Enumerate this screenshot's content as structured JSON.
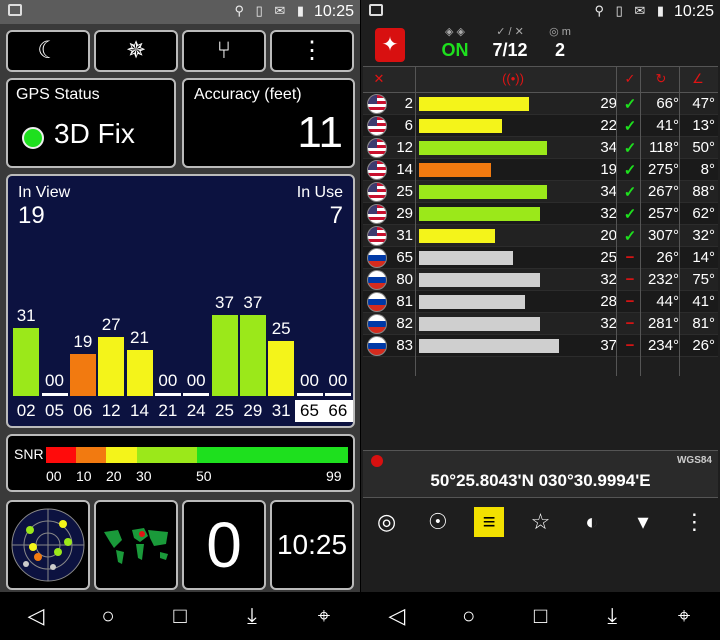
{
  "left": {
    "status_time": "10:25",
    "toolbar": {
      "night_icon": "☾",
      "compass_icon": "✵",
      "share_icon": "⑂",
      "menu_icon": "⋮"
    },
    "gps_status": {
      "label": "GPS Status",
      "value": "3D Fix"
    },
    "accuracy": {
      "label": "Accuracy (feet)",
      "value": "11"
    },
    "sky": {
      "in_view_label": "In View",
      "in_view": "19",
      "in_use_label": "In Use",
      "in_use": "7",
      "bars": [
        {
          "prn": "02",
          "snr": "31",
          "color": "#9be81a",
          "boxed": false
        },
        {
          "prn": "05",
          "snr": "00",
          "color": "#9be81a",
          "boxed": false
        },
        {
          "prn": "06",
          "snr": "19",
          "color": "#f27a10",
          "boxed": false
        },
        {
          "prn": "12",
          "snr": "27",
          "color": "#f4f41a",
          "boxed": false
        },
        {
          "prn": "14",
          "snr": "21",
          "color": "#f4f41a",
          "boxed": false
        },
        {
          "prn": "21",
          "snr": "00",
          "color": "#9be81a",
          "boxed": false
        },
        {
          "prn": "24",
          "snr": "00",
          "color": "#9be81a",
          "boxed": false
        },
        {
          "prn": "25",
          "snr": "37",
          "color": "#9be81a",
          "boxed": false
        },
        {
          "prn": "29",
          "snr": "37",
          "color": "#9be81a",
          "boxed": false
        },
        {
          "prn": "31",
          "snr": "25",
          "color": "#f4f41a",
          "boxed": false
        },
        {
          "prn": "65",
          "snr": "00",
          "color": "#9be81a",
          "boxed": true
        },
        {
          "prn": "66",
          "snr": "00",
          "color": "#9be81a",
          "boxed": true
        }
      ]
    },
    "snr_legend": {
      "label": "SNR",
      "ticks": [
        "00",
        "10",
        "20",
        "30",
        "50",
        "99"
      ]
    },
    "bottom": {
      "big_number": "0",
      "clock": "10:25"
    }
  },
  "right": {
    "status_time": "10:25",
    "top": {
      "gps_state": "ON",
      "sats": "7/12",
      "count": "2",
      "sats_icons": "✓ / ✕",
      "count_icon": "◎ m",
      "state_icon": "◈ ◈"
    },
    "rows": [
      {
        "prn": "2",
        "snr": "29",
        "used": true,
        "az": "66°",
        "el": "47°",
        "flag": "us",
        "color": "#f4f41a"
      },
      {
        "prn": "6",
        "snr": "22",
        "used": true,
        "az": "41°",
        "el": "13°",
        "flag": "us",
        "color": "#f4f41a"
      },
      {
        "prn": "12",
        "snr": "34",
        "used": true,
        "az": "118°",
        "el": "50°",
        "flag": "us",
        "color": "#9be81a"
      },
      {
        "prn": "14",
        "snr": "19",
        "used": true,
        "az": "275°",
        "el": "8°",
        "flag": "us",
        "color": "#f27a10"
      },
      {
        "prn": "25",
        "snr": "34",
        "used": true,
        "az": "267°",
        "el": "88°",
        "flag": "us",
        "color": "#9be81a"
      },
      {
        "prn": "29",
        "snr": "32",
        "used": true,
        "az": "257°",
        "el": "62°",
        "flag": "us",
        "color": "#9be81a"
      },
      {
        "prn": "31",
        "snr": "20",
        "used": true,
        "az": "307°",
        "el": "32°",
        "flag": "us",
        "color": "#f4f41a"
      },
      {
        "prn": "65",
        "snr": "25",
        "used": false,
        "az": "26°",
        "el": "14°",
        "flag": "ru",
        "color": "#cfcfcf"
      },
      {
        "prn": "80",
        "snr": "32",
        "used": false,
        "az": "232°",
        "el": "75°",
        "flag": "ru",
        "color": "#cfcfcf"
      },
      {
        "prn": "81",
        "snr": "28",
        "used": false,
        "az": "44°",
        "el": "41°",
        "flag": "ru",
        "color": "#cfcfcf"
      },
      {
        "prn": "82",
        "snr": "32",
        "used": false,
        "az": "281°",
        "el": "81°",
        "flag": "ru",
        "color": "#cfcfcf"
      },
      {
        "prn": "83",
        "snr": "37",
        "used": false,
        "az": "234°",
        "el": "26°",
        "flag": "ru",
        "color": "#cfcfcf"
      }
    ],
    "datum": "WGS84",
    "coordinates": "50°25.8043'N   030°30.9994'E",
    "tools": [
      "compass-icon",
      "radar-icon",
      "bars-icon",
      "walk-icon",
      "globe-icon",
      "pin-icon",
      "more-icon"
    ],
    "tool_glyphs": [
      "◎",
      "☉",
      "≡",
      "☆",
      "◐",
      "▾",
      "⋮"
    ]
  },
  "nav": {
    "back": "◁",
    "home": "○",
    "recent": "□",
    "down": "⤓",
    "collapse": "⌖"
  }
}
